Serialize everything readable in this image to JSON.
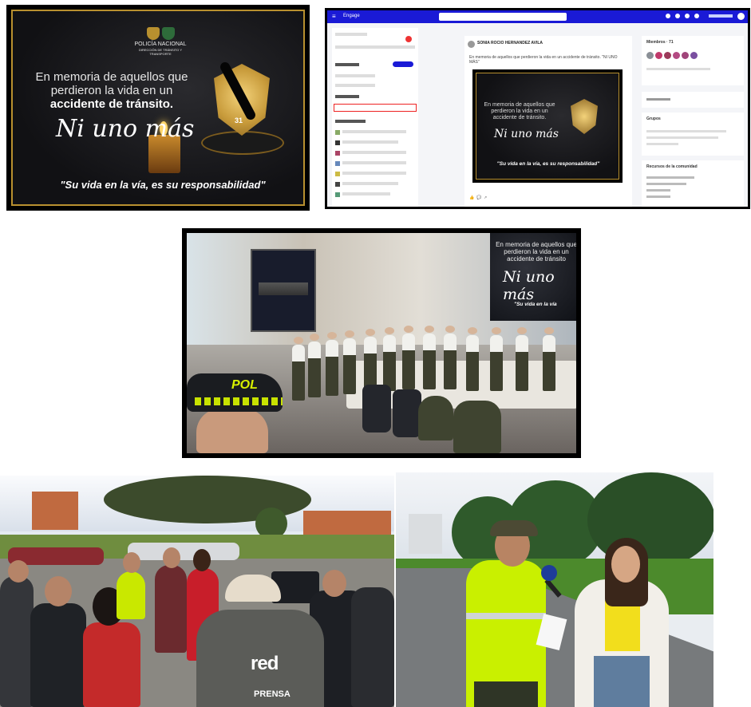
{
  "poster": {
    "agency_line1": "POLICÍA NACIONAL",
    "agency_line2": "DIRECCIÓN DE TRÁNSITO Y TRANSPORTE",
    "memory_line": "En memoria de aquellos que perdieron la vida en un",
    "memory_bold": "accidente de tránsito.",
    "script": "Ni uno más",
    "badge_number": "31",
    "quote": "\"Su vida en la vía, es su responsabilidad\""
  },
  "social": {
    "app_name": "Engage",
    "author": "SONIA ROCIO HERNANDEZ AVILA",
    "post_text": "En memoria de aquellos que perdieron la vida en un accidente de tránsito. \"NI UNO MÁS\"",
    "poster_memory": "En memoria de aquellos que perdieron la vida en un accidente de tránsito.",
    "poster_script": "Ni uno más",
    "poster_quote": "\"Su vida en la vía, es su responsabilidad\"",
    "right_card1_title": "Miembros · 71",
    "right_card2_title": "Grupos",
    "right_card3_title": "Recursos de la comunidad",
    "avatar_colors": [
      "#8a8f96",
      "#c0396b",
      "#9c3a5a",
      "#b34a82",
      "#a0457a",
      "#7a4fa0"
    ]
  },
  "ceremony": {
    "screen_memory": "En memoria de aquellos que perdieron la vida en un accidente de tránsito",
    "screen_script": "Ni uno más",
    "screen_quote": "\"Su vida en la vía",
    "cap_label": "POL"
  },
  "press": {
    "vest_label": "red",
    "vest_sublabel": "PRENSA"
  }
}
